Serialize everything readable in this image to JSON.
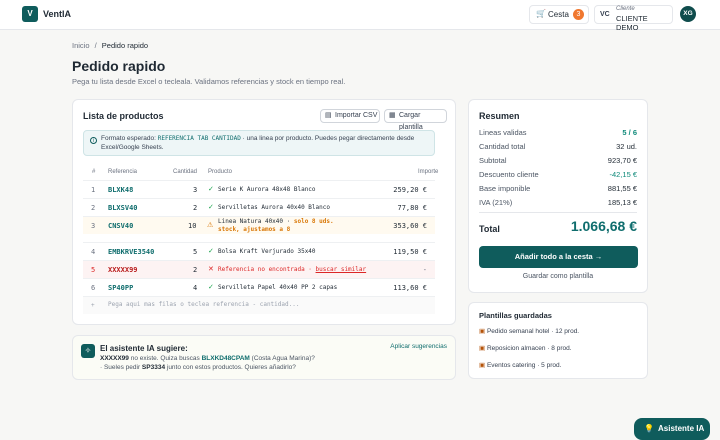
{
  "header": {
    "logo_letter": "V",
    "brand": "VentIA",
    "cart_label": "Cesta",
    "cart_count": "3",
    "client_initials": "VC",
    "client_caption": "Cliente",
    "client_name": "CLIENTE DEMO",
    "avatar": "XG"
  },
  "breadcrumb": {
    "home": "Inicio",
    "sep": "/",
    "current": "Pedido rapido"
  },
  "page": {
    "title": "Pedido rapido",
    "subtitle": "Pega tu lista desde Excel o tecleala. Validamos referencias y stock en tiempo real."
  },
  "products": {
    "title": "Lista de productos",
    "import_csv": "Importar CSV",
    "load_template": "Cargar plantilla",
    "info_prefix": "Formato esperado:",
    "info_code": "REFERENCIA TAB CANTIDAD",
    "info_suffix": "· una linea por producto. Puedes pegar directamente desde Excel/Google Sheets.",
    "columns": {
      "num": "#",
      "ref": "Referencia",
      "qty": "Cantidad",
      "product": "Producto",
      "amount": "Importe"
    },
    "rows": [
      {
        "num": "1",
        "ref": "BLXK48",
        "qty": "3",
        "status": "✓",
        "product": "Serie K Aurora 48x48 Blanco",
        "amount": "259,20 €"
      },
      {
        "num": "2",
        "ref": "BLXSV40",
        "qty": "2",
        "status": "✓",
        "product": "Servilletas Aurora 40x40 Blanco",
        "amount": "77,80 €"
      },
      {
        "num": "3",
        "ref": "CNSV40",
        "qty": "10",
        "status": "⚠",
        "product": "Linea Natura 40x40 ·",
        "product_warn": "solo 8 uds. stock, ajustamos a 8",
        "amount": "353,60 €"
      },
      {
        "num": "4",
        "ref": "EMBKRVE3540",
        "qty": "5",
        "status": "✓",
        "product": "Bolsa Kraft Verjurado 35x40",
        "amount": "119,50 €"
      },
      {
        "num": "5",
        "ref": "XXXXX99",
        "qty": "2",
        "status": "✕",
        "product": "Referencia no encontrada ·",
        "product_link": "buscar similar",
        "amount": "-"
      },
      {
        "num": "6",
        "ref": "SP40PP",
        "qty": "4",
        "status": "✓",
        "product": "Servilleta Papel 40x40 PP 2 capas",
        "amount": "113,60 €"
      }
    ],
    "add_num": "+",
    "add_placeholder": "Pega aqui mas filas o teclea referencia - cantidad..."
  },
  "ai_suggest": {
    "title": "El asistente IA sugiere:",
    "apply": "Aplicar sugerencias",
    "l1_ref": "XXXXX99",
    "l1_mid": "no existe. Quiza buscas",
    "l1_ref2": "BLXKD48CPAM",
    "l1_end": "(Costa Agua Marina)?",
    "l2_pre": "· Sueles pedir",
    "l2_ref": "SP3334",
    "l2_end": "junto con estos productos. Quieres añadirlo?"
  },
  "summary": {
    "title": "Resumen",
    "lines": [
      {
        "label": "Lineas validas",
        "value": "5 / 6",
        "color": "#0f8a7a"
      },
      {
        "label": "Cantidad total",
        "value": "32 ud.",
        "color": "#1f2933"
      },
      {
        "label": "Subtotal",
        "value": "923,70 €",
        "color": "#1f2933"
      },
      {
        "label": "Descuento cliente",
        "value": "-42,15 €",
        "color": "#0f8a7a"
      },
      {
        "label": "Base imponible",
        "value": "881,55 €",
        "color": "#1f2933"
      },
      {
        "label": "IVA (21%)",
        "value": "185,13 €",
        "color": "#1f2933"
      }
    ],
    "total_label": "Total",
    "total_value": "1.066,68 €",
    "add_all": "Añadir todo a la cesta",
    "add_arrow": "→",
    "save_template": "Guardar como plantilla"
  },
  "templates": {
    "title": "Plantillas guardadas",
    "items": [
      "Pedido semanal hotel · 12 prod.",
      "Reposicion almacen · 8 prod.",
      "Eventos catering · 5 prod."
    ]
  },
  "assistant_fab": "Asistente IA"
}
